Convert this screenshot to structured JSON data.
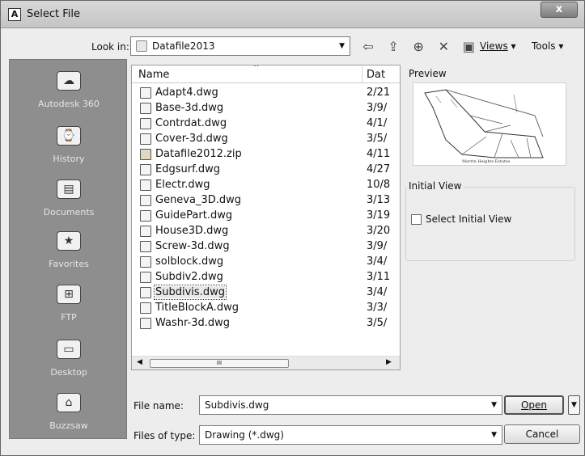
{
  "window": {
    "title": "Select File",
    "close_glyph": "x"
  },
  "lookin": {
    "label": "Look in:",
    "value": "Datafile2013"
  },
  "toolbar": {
    "icons": [
      "back-icon",
      "up-folder-icon",
      "search-web-icon",
      "delete-icon",
      "new-folder-icon"
    ],
    "views_label": "Views",
    "tools_label": "Tools"
  },
  "places": [
    {
      "label": "Autodesk 360",
      "icon": "cloud-icon"
    },
    {
      "label": "History",
      "icon": "history-icon"
    },
    {
      "label": "Documents",
      "icon": "documents-icon"
    },
    {
      "label": "Favorites",
      "icon": "favorites-icon"
    },
    {
      "label": "FTP",
      "icon": "ftp-icon"
    },
    {
      "label": "Desktop",
      "icon": "desktop-icon"
    },
    {
      "label": "Buzzsaw",
      "icon": "buzzsaw-icon"
    }
  ],
  "filelist": {
    "header_name": "Name",
    "header_date": "Dat",
    "files": [
      {
        "name": "Adapt4.dwg",
        "date": "2/21"
      },
      {
        "name": "Base-3d.dwg",
        "date": "3/9/"
      },
      {
        "name": "Contrdat.dwg",
        "date": "4/1/"
      },
      {
        "name": "Cover-3d.dwg",
        "date": "3/5/"
      },
      {
        "name": "Datafile2012.zip",
        "date": "4/11"
      },
      {
        "name": "Edgsurf.dwg",
        "date": "4/27"
      },
      {
        "name": "Electr.dwg",
        "date": "10/8"
      },
      {
        "name": "Geneva_3D.dwg",
        "date": "3/13"
      },
      {
        "name": "GuidePart.dwg",
        "date": "3/19"
      },
      {
        "name": "House3D.dwg",
        "date": "3/20"
      },
      {
        "name": "Screw-3d.dwg",
        "date": "3/9/"
      },
      {
        "name": "solblock.dwg",
        "date": "3/4/"
      },
      {
        "name": "Subdiv2.dwg",
        "date": "3/11"
      },
      {
        "name": "Subdivis.dwg",
        "date": "3/4/"
      },
      {
        "name": "TitleBlockA.dwg",
        "date": "3/3/"
      },
      {
        "name": "Washr-3d.dwg",
        "date": "3/5/"
      }
    ],
    "selected": "Subdivis.dwg",
    "scroll_grip": "III"
  },
  "preview": {
    "label": "Preview",
    "caption": "Merrin Heights Estates"
  },
  "initial_view": {
    "group_label": "Initial View",
    "checkbox_label": "Select Initial View",
    "checked": false
  },
  "filename": {
    "label": "File name:",
    "value": "Subdivis.dwg"
  },
  "filetype": {
    "label": "Files of type:",
    "value": "Drawing (*.dwg)"
  },
  "buttons": {
    "open": "Open",
    "cancel": "Cancel"
  }
}
